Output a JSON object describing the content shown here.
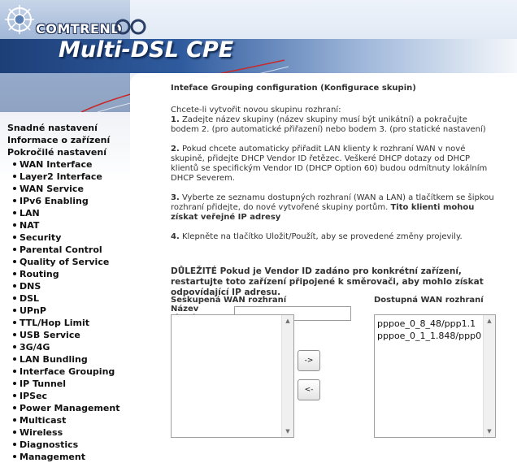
{
  "header": {
    "brand": "COMTREND",
    "product": "Multi-DSL CPE"
  },
  "sidebar": {
    "top_items": [
      {
        "label": "Snadné nastavení"
      },
      {
        "label": "Informace o zařízení"
      },
      {
        "label": "Pokročilé nastavení"
      }
    ],
    "sub_items": [
      {
        "label": "WAN Interface"
      },
      {
        "label": "Layer2 Interface"
      },
      {
        "label": "WAN Service"
      },
      {
        "label": "IPv6 Enabling"
      },
      {
        "label": "LAN"
      },
      {
        "label": "NAT"
      },
      {
        "label": "Security"
      },
      {
        "label": "Parental Control"
      },
      {
        "label": "Quality of Service"
      },
      {
        "label": "Routing"
      },
      {
        "label": "DNS"
      },
      {
        "label": "DSL"
      },
      {
        "label": "UPnP"
      },
      {
        "label": "TTL/Hop Limit"
      },
      {
        "label": "USB Service"
      },
      {
        "label": "3G/4G"
      },
      {
        "label": "LAN Bundling"
      },
      {
        "label": "Interface Grouping"
      },
      {
        "label": "IP Tunnel"
      },
      {
        "label": "IPSec"
      },
      {
        "label": "Power Management"
      },
      {
        "label": "Multicast"
      },
      {
        "label": "Wireless"
      },
      {
        "label": "Diagnostics"
      },
      {
        "label": "Management"
      }
    ]
  },
  "main": {
    "title": "Inteface Grouping configuration (Konfigurace skupin)",
    "intro": "Chcete-li vytvořit novou skupinu rozhraní:",
    "steps": [
      {
        "num": "1.",
        "text": "Zadejte název skupiny (název skupiny musí být unikátní) a pokračujte bodem 2. (pro automatické přiřazení) nebo bodem 3. (pro statické nastavení)",
        "bold_tail": ""
      },
      {
        "num": "2.",
        "text": "Pokud chcete automaticky přiřadit LAN klienty k rozhraní WAN v nové skupině, přidejte DHCP Vendor ID řetězec. Veškeré DHCP dotazy od DHCP klientů se specifickým Vendor ID (DHCP Option 60) budou odmítnuty lokálním DHCP Severem.",
        "bold_tail": ""
      },
      {
        "num": "3.",
        "text": "Vyberte ze seznamu dostupných rozhraní (WAN a LAN) a tlačítkem se šipkou rozhraní přidejte, do nové vytvořené skupiny portům. ",
        "bold_tail": "Tito klienti mohou získat veřejné IP adresy"
      },
      {
        "num": "4.",
        "text": "Klepněte na tlačítko Uložit/Použít, aby se provedené změny projevily.",
        "bold_tail": ""
      }
    ],
    "important": "DŮLEŽITÉ Pokud je Vendor ID zadáno pro konkrétní zařízení, restartujte toto zařízení připojené k směrovači, aby mohlo získat odpovídající IP adresu.",
    "group_name_label": "Název skupiny:",
    "group_name_value": "",
    "grouped_wan_label": "Seskupená WAN rozhraní",
    "available_wan_label": "Dostupná WAN rozhraní",
    "grouped_items": [],
    "available_items": [
      {
        "label": "pppoe_0_8_48/ppp1.1"
      },
      {
        "label": "pppoe_0_1_1.848/ppp0"
      }
    ],
    "add_button": "->",
    "remove_button": "<-"
  },
  "colors": {
    "banner_dark": "#1d3f78",
    "banner_light": "#9fb7da",
    "text": "#333333"
  }
}
